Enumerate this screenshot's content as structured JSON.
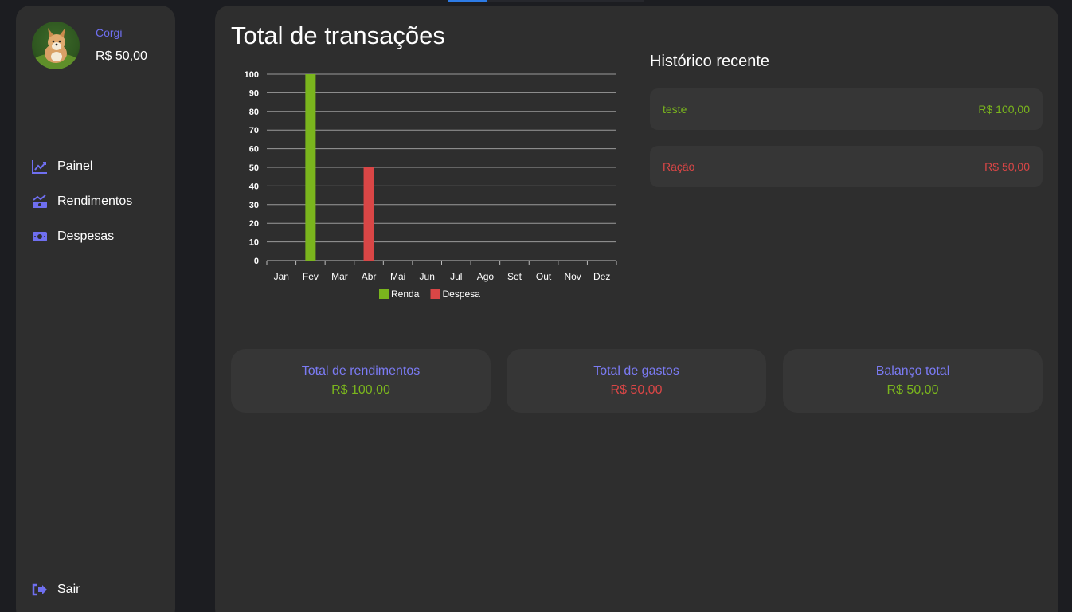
{
  "colors": {
    "accent": "#6f6ff0",
    "income": "#7ab51d",
    "expense": "#d94646",
    "panel": "#2e2e2e",
    "card": "#363636"
  },
  "user": {
    "name": "Corgi",
    "balance": "R$ 50,00"
  },
  "nav": {
    "items": [
      {
        "label": "Painel",
        "icon": "chart-line-icon"
      },
      {
        "label": "Rendimentos",
        "icon": "money-trend-icon"
      },
      {
        "label": "Despesas",
        "icon": "cash-icon"
      }
    ],
    "logout_label": "Sair"
  },
  "main": {
    "title": "Total de transações"
  },
  "history": {
    "title": "Histórico recente",
    "items": [
      {
        "name": "teste",
        "amount": "R$ 100,00",
        "type": "income"
      },
      {
        "name": "Ração",
        "amount": "R$ 50,00",
        "type": "expense"
      }
    ]
  },
  "summary": {
    "income_label": "Total de rendimentos",
    "income_value": "R$ 100,00",
    "expense_label": "Total de gastos",
    "expense_value": "R$ 50,00",
    "balance_label": "Balanço total",
    "balance_value": "R$ 50,00"
  },
  "chart_data": {
    "type": "bar",
    "categories": [
      "Jan",
      "Fev",
      "Mar",
      "Abr",
      "Mai",
      "Jun",
      "Jul",
      "Ago",
      "Set",
      "Out",
      "Nov",
      "Dez"
    ],
    "series": [
      {
        "name": "Renda",
        "color": "#7ab51d",
        "values": [
          0,
          100,
          0,
          0,
          0,
          0,
          0,
          0,
          0,
          0,
          0,
          0
        ]
      },
      {
        "name": "Despesa",
        "color": "#d94646",
        "values": [
          0,
          0,
          0,
          50,
          0,
          0,
          0,
          0,
          0,
          0,
          0,
          0
        ]
      }
    ],
    "ylim": [
      0,
      100
    ],
    "yticks": [
      0,
      10,
      20,
      30,
      40,
      50,
      60,
      70,
      80,
      90,
      100
    ],
    "grid": true,
    "legend": "bottom-center"
  }
}
